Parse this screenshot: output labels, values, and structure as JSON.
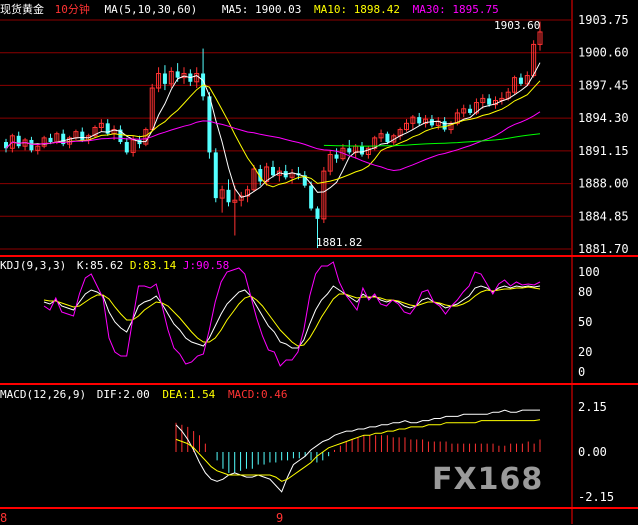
{
  "header": {
    "instrument": "现货黄金",
    "period": "10分钟",
    "ma_label": "MA(5,10,30,60)",
    "ma5": "MA5: 1900.03",
    "ma10": "MA10: 1898.42",
    "ma30": "MA30: 1895.75"
  },
  "kdj_header": {
    "label": "KDJ(9,3,3)",
    "k": "K:85.62",
    "d": "D:83.14",
    "j": "J:90.58"
  },
  "macd_header": {
    "label": "MACD(12,26,9)",
    "dif": "DIF:2.00",
    "dea": "DEA:1.54",
    "macd": "MACD:0.46"
  },
  "price_axis": [
    "1903.75",
    "1900.60",
    "1897.45",
    "1894.30",
    "1891.15",
    "1888.00",
    "1884.85",
    "1881.70"
  ],
  "kdj_axis": [
    "100",
    "80",
    "50",
    "20",
    "0"
  ],
  "macd_axis": [
    "2.15",
    "0.00",
    "-2.15"
  ],
  "annotations": {
    "high": "1903.60",
    "low": "1881.82"
  },
  "dates": [
    "8",
    "9"
  ],
  "watermark": "FX168",
  "colors": {
    "up": "#ff3232",
    "down": "#54ffff",
    "ma5": "#ffffff",
    "ma10": "#ffff00",
    "ma30": "#ff00ff",
    "ma60": "#00ff00",
    "grid": "#8b0000",
    "frame": "#ff0000"
  },
  "chart_data": [
    {
      "type": "candlestick",
      "title": "现货黄金 10分钟",
      "ylim": [
        1881.7,
        1903.75
      ],
      "candles": [
        [
          1892.0,
          1892.3,
          1891.0,
          1891.4
        ],
        [
          1891.4,
          1892.8,
          1891.0,
          1892.6
        ],
        [
          1892.6,
          1893.0,
          1891.4,
          1891.6
        ],
        [
          1891.6,
          1892.4,
          1891.2,
          1892.2
        ],
        [
          1892.2,
          1892.5,
          1891.0,
          1891.2
        ],
        [
          1891.2,
          1891.8,
          1890.8,
          1891.6
        ],
        [
          1891.6,
          1892.6,
          1891.4,
          1892.4
        ],
        [
          1892.4,
          1892.8,
          1891.8,
          1892.0
        ],
        [
          1892.0,
          1893.0,
          1891.8,
          1892.8
        ],
        [
          1892.8,
          1893.2,
          1891.6,
          1891.8
        ],
        [
          1891.8,
          1892.6,
          1891.4,
          1892.4
        ],
        [
          1892.4,
          1893.2,
          1892.2,
          1893.0
        ],
        [
          1893.0,
          1893.4,
          1892.0,
          1892.2
        ],
        [
          1892.2,
          1892.8,
          1891.8,
          1892.6
        ],
        [
          1892.6,
          1893.6,
          1892.4,
          1893.4
        ],
        [
          1893.4,
          1894.2,
          1893.0,
          1893.8
        ],
        [
          1893.8,
          1894.2,
          1892.6,
          1892.8
        ],
        [
          1892.8,
          1893.6,
          1892.2,
          1893.2
        ],
        [
          1893.2,
          1893.6,
          1891.8,
          1892.0
        ],
        [
          1892.0,
          1892.4,
          1890.8,
          1891.0
        ],
        [
          1891.0,
          1892.6,
          1890.6,
          1892.2
        ],
        [
          1892.2,
          1892.6,
          1891.4,
          1891.8
        ],
        [
          1891.8,
          1893.4,
          1891.6,
          1893.2
        ],
        [
          1893.2,
          1897.6,
          1893.0,
          1897.2
        ],
        [
          1897.2,
          1899.2,
          1896.8,
          1898.6
        ],
        [
          1898.6,
          1899.4,
          1897.0,
          1897.6
        ],
        [
          1897.6,
          1899.2,
          1897.2,
          1898.8
        ],
        [
          1898.8,
          1899.6,
          1897.8,
          1898.2
        ],
        [
          1898.2,
          1899.2,
          1897.6,
          1898.6
        ],
        [
          1898.6,
          1899.0,
          1897.4,
          1897.8
        ],
        [
          1897.8,
          1899.2,
          1897.2,
          1898.6
        ],
        [
          1898.6,
          1901.0,
          1896.0,
          1896.4
        ],
        [
          1896.4,
          1896.8,
          1890.4,
          1891.0
        ],
        [
          1891.0,
          1891.4,
          1886.2,
          1886.6
        ],
        [
          1886.6,
          1887.8,
          1885.2,
          1887.4
        ],
        [
          1887.4,
          1888.4,
          1885.8,
          1886.2
        ],
        [
          1886.2,
          1887.8,
          1883.0,
          1886.4
        ],
        [
          1886.4,
          1887.2,
          1885.8,
          1886.8
        ],
        [
          1886.8,
          1887.8,
          1886.2,
          1887.4
        ],
        [
          1887.4,
          1889.8,
          1887.2,
          1889.4
        ],
        [
          1889.4,
          1889.8,
          1887.8,
          1888.2
        ],
        [
          1888.2,
          1890.0,
          1887.8,
          1889.6
        ],
        [
          1889.6,
          1890.2,
          1888.6,
          1888.8
        ],
        [
          1888.8,
          1889.6,
          1888.2,
          1889.2
        ],
        [
          1889.2,
          1889.8,
          1888.4,
          1888.6
        ],
        [
          1888.6,
          1889.4,
          1888.0,
          1889.0
        ],
        [
          1889.0,
          1889.6,
          1888.4,
          1888.8
        ],
        [
          1888.8,
          1889.2,
          1887.6,
          1887.8
        ],
        [
          1887.8,
          1888.2,
          1885.4,
          1885.6
        ],
        [
          1885.6,
          1885.8,
          1881.8,
          1884.6
        ],
        [
          1884.6,
          1889.6,
          1884.2,
          1889.2
        ],
        [
          1889.2,
          1891.2,
          1888.8,
          1890.8
        ],
        [
          1890.8,
          1891.4,
          1890.0,
          1890.4
        ],
        [
          1890.4,
          1891.8,
          1890.2,
          1891.4
        ],
        [
          1891.4,
          1892.2,
          1890.8,
          1891.0
        ],
        [
          1891.0,
          1891.8,
          1890.4,
          1891.6
        ],
        [
          1891.6,
          1892.0,
          1890.6,
          1890.8
        ],
        [
          1890.8,
          1891.6,
          1890.4,
          1891.4
        ],
        [
          1891.4,
          1892.6,
          1891.2,
          1892.4
        ],
        [
          1892.4,
          1893.2,
          1892.0,
          1892.8
        ],
        [
          1892.8,
          1893.0,
          1891.8,
          1892.0
        ],
        [
          1892.0,
          1892.8,
          1891.6,
          1892.6
        ],
        [
          1892.6,
          1893.4,
          1892.2,
          1893.2
        ],
        [
          1893.2,
          1894.2,
          1893.0,
          1893.8
        ],
        [
          1893.8,
          1894.6,
          1893.2,
          1894.4
        ],
        [
          1894.4,
          1894.8,
          1893.6,
          1893.8
        ],
        [
          1893.8,
          1894.6,
          1893.4,
          1894.2
        ],
        [
          1894.2,
          1894.6,
          1893.4,
          1893.6
        ],
        [
          1893.6,
          1894.4,
          1893.2,
          1894.0
        ],
        [
          1894.0,
          1894.4,
          1893.0,
          1893.2
        ],
        [
          1893.2,
          1894.0,
          1892.8,
          1893.8
        ],
        [
          1893.8,
          1895.2,
          1893.6,
          1894.8
        ],
        [
          1894.8,
          1895.6,
          1894.4,
          1895.2
        ],
        [
          1895.2,
          1895.6,
          1894.6,
          1894.8
        ],
        [
          1894.8,
          1896.2,
          1894.6,
          1895.8
        ],
        [
          1895.8,
          1896.6,
          1895.2,
          1896.2
        ],
        [
          1896.2,
          1896.6,
          1895.4,
          1895.6
        ],
        [
          1895.6,
          1896.4,
          1895.2,
          1896.0
        ],
        [
          1896.0,
          1896.8,
          1895.6,
          1896.2
        ],
        [
          1896.2,
          1897.2,
          1896.0,
          1896.8
        ],
        [
          1896.8,
          1898.4,
          1896.6,
          1898.2
        ],
        [
          1898.2,
          1898.6,
          1897.4,
          1897.6
        ],
        [
          1897.6,
          1898.8,
          1897.4,
          1898.4
        ],
        [
          1898.4,
          1901.8,
          1898.2,
          1901.4
        ],
        [
          1901.4,
          1903.6,
          1900.8,
          1902.6
        ]
      ]
    },
    {
      "type": "line",
      "title": "KDJ(9,3,3)",
      "ylim": [
        0,
        100
      ],
      "series": [
        {
          "name": "K",
          "values": [
            70,
            68,
            72,
            66,
            64,
            62,
            70,
            78,
            82,
            80,
            76,
            60,
            50,
            44,
            40,
            52,
            66,
            70,
            72,
            76,
            68,
            58,
            48,
            42,
            34,
            30,
            28,
            26,
            34,
            46,
            58,
            68,
            74,
            80,
            82,
            76,
            66,
            56,
            46,
            40,
            30,
            28,
            24,
            24,
            32,
            48,
            62,
            72,
            78,
            86,
            82,
            78,
            74,
            70,
            78,
            74,
            76,
            72,
            70,
            72,
            70,
            66,
            64,
            66,
            72,
            74,
            70,
            68,
            64,
            66,
            68,
            72,
            76,
            84,
            86,
            84,
            80,
            84,
            86,
            84,
            86,
            85,
            86,
            85,
            86
          ]
        },
        {
          "name": "D",
          "values": [
            72,
            71,
            71,
            69,
            67,
            65,
            66,
            70,
            74,
            77,
            77,
            73,
            65,
            58,
            52,
            52,
            56,
            62,
            66,
            70,
            69,
            66,
            60,
            54,
            47,
            40,
            34,
            30,
            30,
            34,
            42,
            52,
            60,
            68,
            74,
            76,
            72,
            66,
            58,
            50,
            42,
            36,
            30,
            26,
            27,
            34,
            44,
            55,
            64,
            73,
            78,
            78,
            76,
            74,
            75,
            75,
            75,
            74,
            72,
            72,
            71,
            69,
            67,
            66,
            68,
            70,
            70,
            69,
            67,
            66,
            66,
            68,
            71,
            76,
            80,
            82,
            81,
            82,
            83,
            83,
            84,
            84,
            85,
            84,
            83
          ]
        },
        {
          "name": "J",
          "values": [
            66,
            62,
            74,
            60,
            58,
            56,
            78,
            94,
            98,
            86,
            74,
            34,
            20,
            16,
            16,
            52,
            86,
            86,
            84,
            88,
            66,
            42,
            24,
            18,
            8,
            10,
            16,
            18,
            42,
            70,
            90,
            100,
            102,
            104,
            98,
            76,
            54,
            36,
            22,
            20,
            6,
            12,
            12,
            20,
            42,
            76,
            98,
            106,
            106,
            112,
            90,
            78,
            70,
            62,
            84,
            72,
            78,
            68,
            66,
            72,
            68,
            60,
            58,
            66,
            80,
            82,
            70,
            66,
            58,
            66,
            72,
            80,
            86,
            100,
            98,
            88,
            78,
            88,
            92,
            86,
            90,
            87,
            88,
            87,
            90
          ]
        }
      ]
    },
    {
      "type": "bar+line",
      "title": "MACD(12,26,9)",
      "ylim": [
        -2.15,
        2.15
      ],
      "series": [
        {
          "name": "MACD",
          "values": [
            1.4,
            1.3,
            1.2,
            1.0,
            0.8,
            0.4,
            0.0,
            -0.4,
            -0.8,
            -1.0,
            -1.0,
            -0.9,
            -0.8,
            -0.8,
            -0.6,
            -0.6,
            -0.5,
            -0.5,
            -0.4,
            -0.4,
            -0.3,
            -0.3,
            -0.2,
            -0.4,
            -0.5,
            -0.4,
            -0.2,
            0.1,
            0.3,
            0.5,
            0.6,
            0.7,
            0.8,
            0.8,
            0.8,
            0.8,
            0.8,
            0.7,
            0.7,
            0.7,
            0.6,
            0.6,
            0.6,
            0.5,
            0.5,
            0.5,
            0.5,
            0.4,
            0.4,
            0.4,
            0.4,
            0.4,
            0.4,
            0.4,
            0.4,
            0.3,
            0.3,
            0.4,
            0.4,
            0.4,
            0.5,
            0.4,
            0.6
          ]
        },
        {
          "name": "DIF",
          "values": [
            1.3,
            1.0,
            0.6,
            0.1,
            -0.5,
            -1.0,
            -1.3,
            -1.4,
            -1.3,
            -1.1,
            -1.0,
            -1.1,
            -1.2,
            -1.2,
            -1.1,
            -1.2,
            -1.3,
            -1.6,
            -1.9,
            -1.2,
            -0.6,
            -0.4,
            -0.2,
            0.1,
            0.3,
            0.5,
            0.6,
            0.8,
            0.9,
            1.0,
            1.0,
            1.1,
            1.1,
            1.2,
            1.2,
            1.3,
            1.3,
            1.4,
            1.4,
            1.5,
            1.4,
            1.4,
            1.5,
            1.5,
            1.6,
            1.6,
            1.7,
            1.7,
            1.7,
            1.8,
            1.8,
            1.8,
            1.8,
            1.8,
            1.9,
            1.9,
            2.0,
            1.9,
            1.9,
            2.0,
            2.0,
            2.0,
            2.0
          ]
        },
        {
          "name": "DEA",
          "values": [
            0.6,
            0.5,
            0.4,
            0.2,
            -0.1,
            -0.4,
            -0.7,
            -0.9,
            -1.0,
            -1.1,
            -1.1,
            -1.1,
            -1.1,
            -1.1,
            -1.1,
            -1.1,
            -1.1,
            -1.2,
            -1.4,
            -1.3,
            -1.1,
            -0.9,
            -0.7,
            -0.5,
            -0.2,
            0.0,
            0.2,
            0.3,
            0.4,
            0.5,
            0.6,
            0.7,
            0.8,
            0.8,
            0.9,
            0.9,
            1.0,
            1.0,
            1.1,
            1.1,
            1.2,
            1.2,
            1.2,
            1.3,
            1.3,
            1.3,
            1.4,
            1.4,
            1.4,
            1.4,
            1.4,
            1.4,
            1.5,
            1.5,
            1.5,
            1.5,
            1.5,
            1.5,
            1.5,
            1.5,
            1.5,
            1.5,
            1.54
          ]
        }
      ]
    }
  ]
}
